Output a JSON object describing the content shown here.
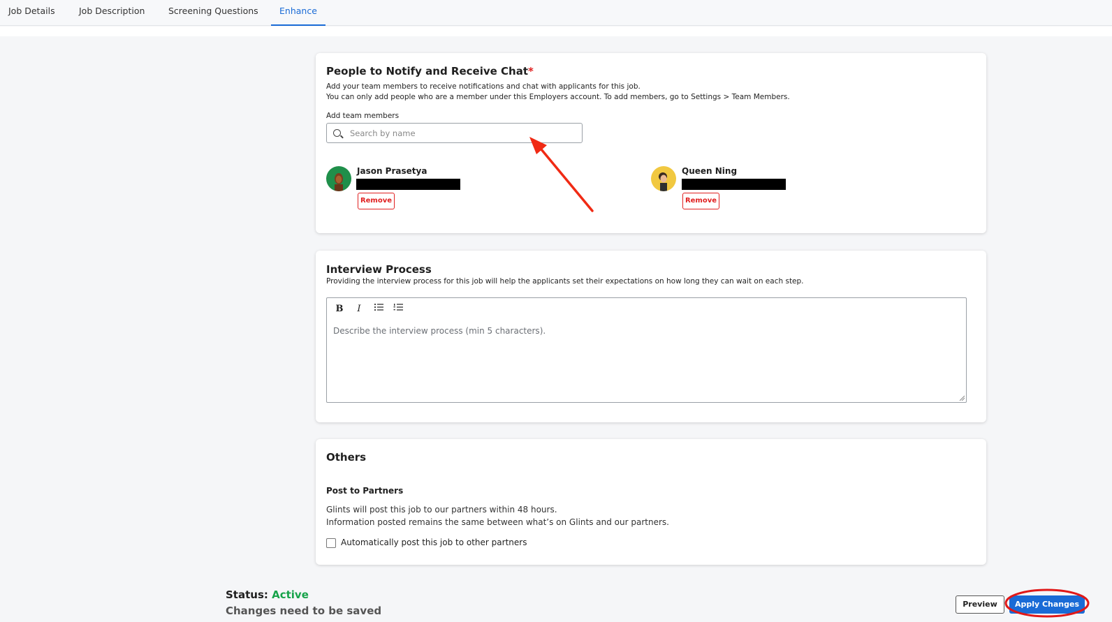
{
  "tabs": [
    {
      "label": "Job Details"
    },
    {
      "label": "Job Description"
    },
    {
      "label": "Screening Questions"
    },
    {
      "label": "Enhance"
    }
  ],
  "notify": {
    "title": "People to Notify and Receive Chat",
    "required_mark": "*",
    "desc1": "Add your team members to receive notifications and chat with applicants for this job.",
    "desc2": "You can only add people who are a member under this Employers account. To add members, go to Settings > Team Members.",
    "field_label": "Add team members",
    "search_placeholder": "Search by name",
    "members": [
      {
        "name": "Jason Prasetya",
        "remove_label": "Remove"
      },
      {
        "name": "Queen Ning",
        "remove_label": "Remove"
      }
    ]
  },
  "interview": {
    "title": "Interview Process",
    "desc": "Providing the interview process for this job will help the applicants set their expectations on how long they can wait on each step.",
    "toolbar": {
      "bold": "B",
      "italic": "I"
    },
    "placeholder": "Describe the interview process (min 5 characters)."
  },
  "others": {
    "title": "Others",
    "subtitle": "Post to Partners",
    "line1": "Glints will post this job to our partners within 48 hours.",
    "line2": "Information posted remains the same between what’s on Glints and our partners.",
    "checkbox_label": "Automatically post this job to other partners"
  },
  "footer": {
    "status_label": "Status:",
    "status_value": "Active",
    "changes_note": "Changes need to be saved",
    "preview_label": "Preview",
    "apply_label": "Apply Changes"
  },
  "colors": {
    "accent": "#1a6bd6",
    "danger": "#e02020",
    "status_active": "#17a34a"
  }
}
